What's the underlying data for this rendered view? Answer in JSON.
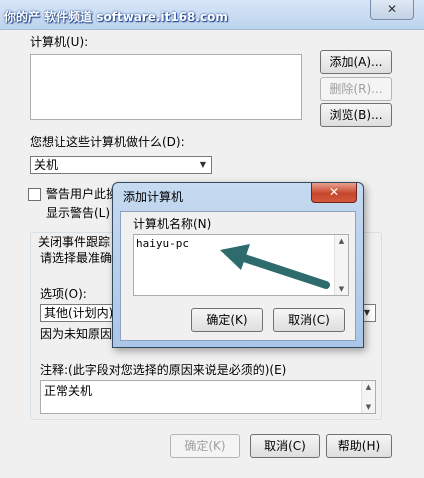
{
  "watermark": "你的产 软件频道 software.it168.com",
  "main": {
    "close_glyph": "✕",
    "computers_label": "计算机(U):",
    "add_button": "添加(A)...",
    "remove_button": "删除(R)...",
    "browse_button": "浏览(B)...",
    "action_prompt": "您想让这些计算机做什么(D):",
    "action_value": "关机",
    "warn_label": "警告用户此操",
    "warn_sub_label": "显示警告(L)",
    "event_group_title": "关闭事件跟踪",
    "event_prompt": "请选择最准确",
    "option_label": "选项(O):",
    "option_value": "其他(计划内)",
    "option_desc": "因为未知原因",
    "comment_label": "注释:(此字段对您选择的原因来说是必须的)(E)",
    "comment_value": "正常关机",
    "ok_button": "确定(K)",
    "cancel_button": "取消(C)",
    "help_button": "帮助(H)"
  },
  "dialog": {
    "title": "添加计算机",
    "close_glyph": "✕",
    "name_label": "计算机名称(N)",
    "name_value": "haiyu-pc",
    "ok_button": "确定(K)",
    "cancel_button": "取消(C)"
  },
  "colors": {
    "arrow": "#2e6b6c",
    "title_bar": "#bcd3ee",
    "dialog_close": "#c7452d"
  }
}
